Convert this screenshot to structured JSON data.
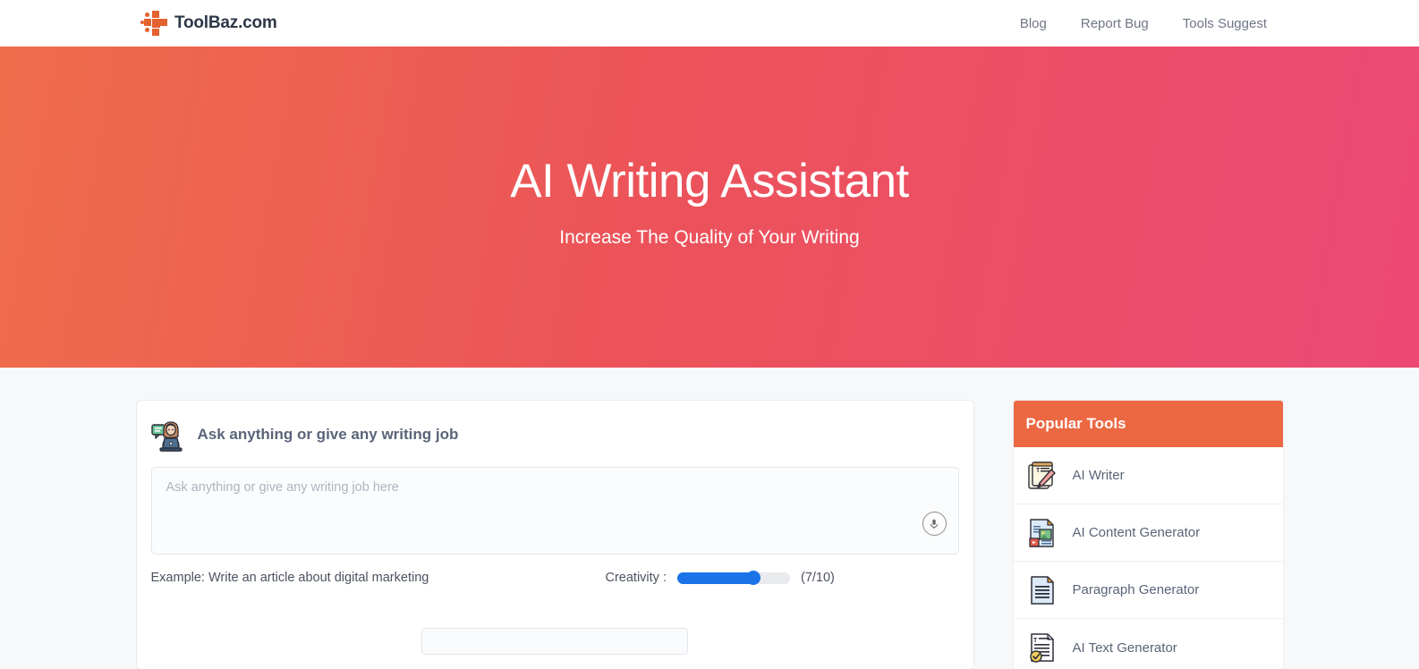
{
  "header": {
    "brand_name": "ToolBaz.com",
    "logo_icon": "toolbaz-cross-logo-icon",
    "nav": [
      {
        "label": "Blog",
        "name": "nav-link-blog"
      },
      {
        "label": "Report Bug",
        "name": "nav-link-report-bug"
      },
      {
        "label": "Tools Suggest",
        "name": "nav-link-tools-suggest"
      }
    ]
  },
  "hero": {
    "title": "AI Writing Assistant",
    "subtitle": "Increase The Quality of Your Writing",
    "gradient_start": "#ef6d4b",
    "gradient_end": "#ec4a75"
  },
  "main": {
    "head_icon": "person-at-laptop-icon",
    "head_title": "Ask anything or give any writing job",
    "prompt_placeholder": "Ask anything or give any writing job here",
    "prompt_value": "",
    "mic_icon": "microphone-icon",
    "example_text": "Example: Write an article about digital marketing",
    "creativity_label": "Creativity :",
    "creativity_value": 7,
    "creativity_min": 0,
    "creativity_max": 10,
    "creativity_ratio": "(7/10)",
    "slider_color": "#1a73e8"
  },
  "sidebar": {
    "title": "Popular Tools",
    "header_color": "#ec6843",
    "items": [
      {
        "label": "AI Writer",
        "icon": "notepad-pencil-icon"
      },
      {
        "label": "AI Content Generator",
        "icon": "document-media-icon"
      },
      {
        "label": "Paragraph Generator",
        "icon": "document-lines-icon"
      },
      {
        "label": "AI Text Generator",
        "icon": "document-text-check-icon"
      }
    ]
  }
}
